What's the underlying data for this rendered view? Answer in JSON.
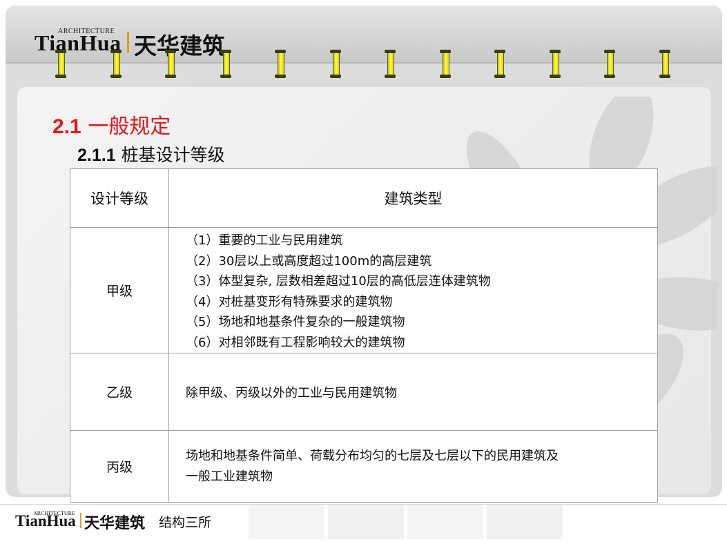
{
  "header": {
    "logo_small": "ARCHITECTURE",
    "logo_big": "TianHua",
    "logo_cn": "天华建筑"
  },
  "section": {
    "number": "2.1",
    "title": "一般规定",
    "sub_number": "2.1.1",
    "sub_title": "桩基设计等级"
  },
  "table": {
    "headers": [
      "设计等级",
      "建筑类型"
    ],
    "rows": [
      {
        "grade": "甲级",
        "types": [
          "（1）重要的工业与民用建筑",
          "（2）30层以上或高度超过100m的高层建筑",
          "（3）体型复杂, 层数相差超过10层的高低层连体建筑物",
          "（4）对桩基变形有特殊要求的建筑物",
          "（5）场地和地基条件复杂的一般建筑物",
          "（6）对相邻既有工程影响较大的建筑物"
        ]
      },
      {
        "grade": "乙级",
        "types": [
          "除甲级、丙级以外的工业与民用建筑物"
        ]
      },
      {
        "grade": "丙级",
        "types": [
          "场地和地基条件简单、荷载分布均匀的七层及七层以下的民用建筑及",
          "一般工业建筑物"
        ]
      }
    ]
  },
  "footer": {
    "logo_small": "ARCHITECTURE",
    "logo_big": "TianHua",
    "logo_cn": "天华建筑",
    "dept": "结构三所"
  },
  "colors": {
    "title_red": "#e8161b",
    "logo_bar": "#e39a27",
    "ring_yellow": "#ffff40"
  }
}
